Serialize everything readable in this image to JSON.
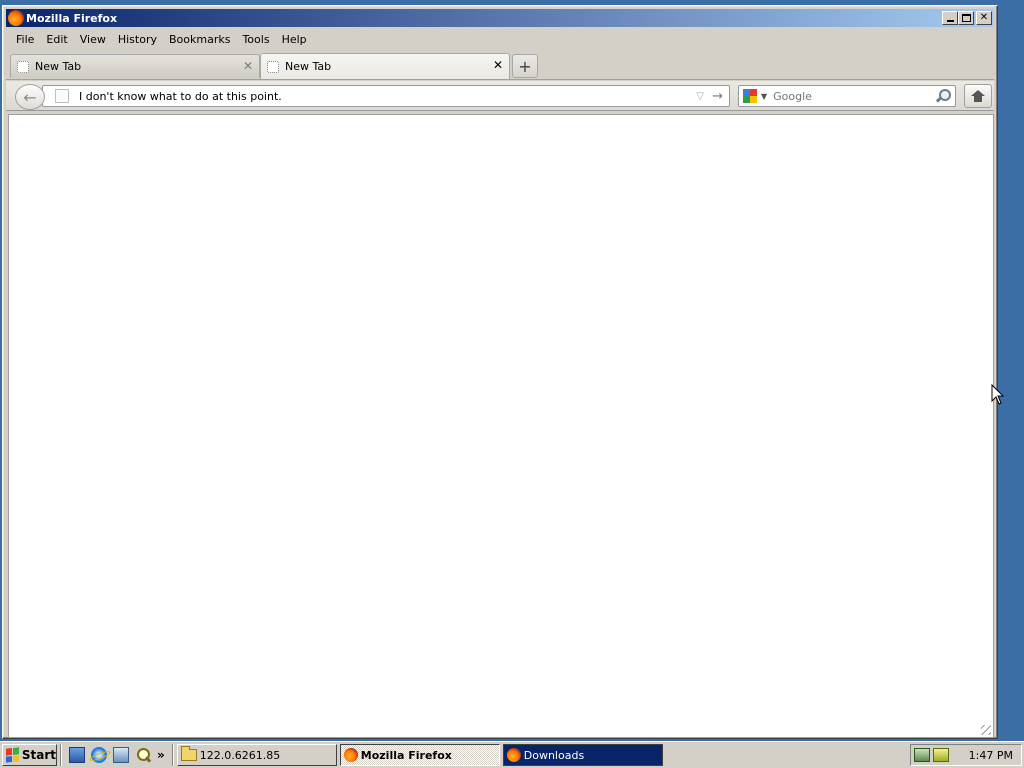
{
  "window": {
    "title": "Mozilla Firefox",
    "buttons": {
      "minimize": "minimize",
      "maximize": "maximize",
      "close": "✕"
    }
  },
  "menubar": {
    "items": [
      "File",
      "Edit",
      "View",
      "History",
      "Bookmarks",
      "Tools",
      "Help"
    ]
  },
  "tabs": [
    {
      "label": "New Tab",
      "active": false,
      "close": "✕"
    },
    {
      "label": "New Tab",
      "active": true,
      "close": "✕"
    }
  ],
  "new_tab_button": "+",
  "navbar": {
    "back_icon": "back-arrow-icon",
    "url_value": "I don't know what to do at this point.",
    "url_dropdown_glyph": "▽",
    "go_glyph": "→",
    "search_placeholder": "Google",
    "search_engine_icon": "google-icon",
    "home_icon": "home-icon"
  },
  "taskbar": {
    "start_label": "Start",
    "quick_launch_more": "»",
    "tasks": [
      {
        "label": "122.0.6261.85",
        "icon": "folder-icon",
        "state": "raised"
      },
      {
        "label": "Mozilla Firefox",
        "icon": "firefox-icon",
        "state": "pressed"
      },
      {
        "label": "Downloads",
        "icon": "firefox-icon",
        "state": "highlight"
      }
    ],
    "clock": "1:47 PM"
  },
  "colors": {
    "titlebar_start": "#0a246a",
    "titlebar_end": "#a6caf0",
    "desktop": "#3a6ea5",
    "chrome": "#d4d0c8"
  }
}
